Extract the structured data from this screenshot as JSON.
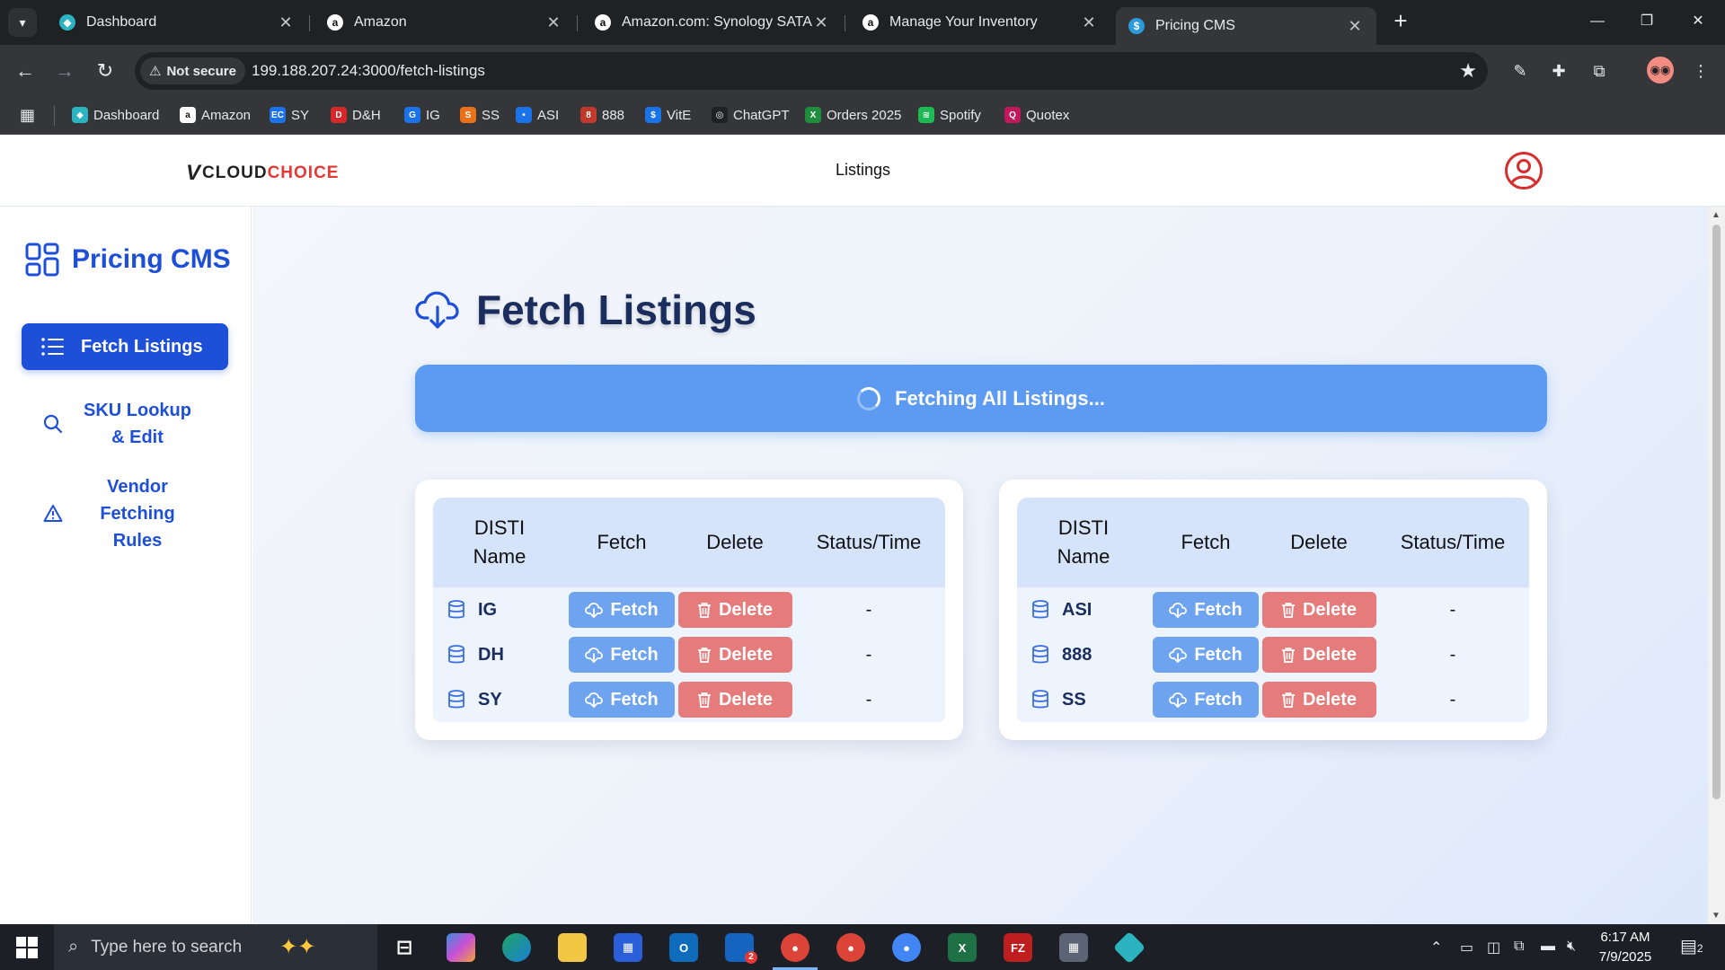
{
  "browser": {
    "tabs": [
      {
        "title": "Dashboard",
        "icon": "dashboard-favicon",
        "active": false
      },
      {
        "title": "Amazon",
        "icon": "amazon-favicon",
        "active": false
      },
      {
        "title": "Amazon.com: Synology SATA SS",
        "icon": "amazon-favicon",
        "active": false
      },
      {
        "title": "Manage Your Inventory",
        "icon": "amazon-favicon",
        "active": false
      },
      {
        "title": "Pricing CMS",
        "icon": "dollar-favicon",
        "active": true
      }
    ],
    "security_label": "Not secure",
    "url": "199.188.207.24:3000/fetch-listings",
    "bookmarks": [
      {
        "label": "Dashboard",
        "color": "#2bb3c0",
        "icon": "◆"
      },
      {
        "label": "Amazon",
        "color": "#ffffff",
        "icon": "a"
      },
      {
        "label": "SY",
        "color": "#1a73e8",
        "icon": "EC"
      },
      {
        "label": "D&H",
        "color": "#d62828",
        "icon": "D"
      },
      {
        "label": "IG",
        "color": "#1a73e8",
        "icon": "G"
      },
      {
        "label": "SS",
        "color": "#e8711a",
        "icon": "S"
      },
      {
        "label": "ASI",
        "color": "#1a73e8",
        "icon": "•"
      },
      {
        "label": "888",
        "color": "#c0392b",
        "icon": "8"
      },
      {
        "label": "VitE",
        "color": "#1a73e8",
        "icon": "$"
      },
      {
        "label": "ChatGPT",
        "color": "#202124",
        "icon": "◎"
      },
      {
        "label": "Orders 2025",
        "color": "#1e8e3e",
        "icon": "X"
      },
      {
        "label": "Spotify",
        "color": "#1db954",
        "icon": "≋"
      },
      {
        "label": "Quotex",
        "color": "#c2185b",
        "icon": "Q"
      }
    ]
  },
  "header": {
    "logo_v": "V",
    "logo_cloud": "CLOUD",
    "logo_choice": "CHOICE",
    "title": "Listings"
  },
  "sidebar": {
    "brand": "Pricing CMS",
    "items": [
      {
        "label": "Fetch Listings",
        "icon": "list-icon",
        "active": true
      },
      {
        "label": "SKU Lookup & Edit",
        "icon": "search-icon",
        "active": false
      },
      {
        "label": "Vendor Fetching Rules",
        "icon": "warning-icon",
        "active": false
      }
    ]
  },
  "main": {
    "title": "Fetch Listings",
    "fetch_all_label": "Fetching All Listings...",
    "columns": [
      "DISTI Name",
      "Fetch",
      "Delete",
      "Status/Time"
    ],
    "fetch_label": "Fetch",
    "delete_label": "Delete",
    "tables": [
      {
        "rows": [
          {
            "name": "IG",
            "status": "-"
          },
          {
            "name": "DH",
            "status": "-"
          },
          {
            "name": "SY",
            "status": "-"
          }
        ]
      },
      {
        "rows": [
          {
            "name": "ASI",
            "status": "-"
          },
          {
            "name": "888",
            "status": "-"
          },
          {
            "name": "SS",
            "status": "-"
          }
        ]
      }
    ]
  },
  "taskbar": {
    "search_placeholder": "Type here to search",
    "time": "6:17 AM",
    "date": "7/9/2025",
    "notification_count": "2",
    "outlook_badge": "2"
  },
  "colors": {
    "primary": "#1e4fd8",
    "fetch_button": "#6ea3f0",
    "delete_button": "#e57b7b",
    "banner": "#5d9bf2"
  }
}
